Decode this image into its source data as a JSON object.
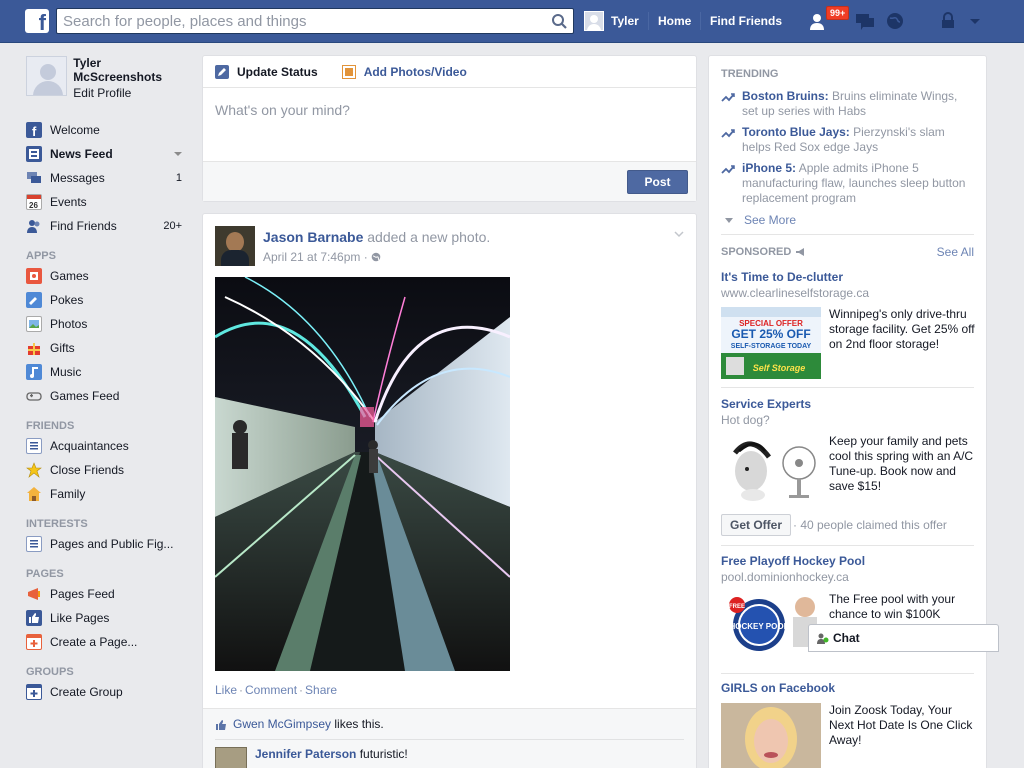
{
  "topbar": {
    "logo": "f",
    "search_placeholder": "Search for people, places and things",
    "user_name": "Tyler",
    "home": "Home",
    "find_friends": "Find Friends",
    "friend_requests_badge": "99+"
  },
  "profile": {
    "name": "Tyler McScreenshots",
    "edit": "Edit Profile"
  },
  "left_nav": {
    "main": [
      {
        "label": "Welcome",
        "icon": "facebook-icon",
        "count": ""
      },
      {
        "label": "News Feed",
        "icon": "news-feed-icon",
        "count": ""
      },
      {
        "label": "Messages",
        "icon": "messages-icon",
        "count": "1"
      },
      {
        "label": "Events",
        "icon": "calendar-icon",
        "icon_text": "26",
        "count": ""
      },
      {
        "label": "Find Friends",
        "icon": "friends-icon",
        "count": "20+"
      }
    ],
    "apps_header": "APPS",
    "apps": [
      {
        "label": "Games",
        "icon": "games-icon"
      },
      {
        "label": "Pokes",
        "icon": "pokes-icon"
      },
      {
        "label": "Photos",
        "icon": "photos-icon"
      },
      {
        "label": "Gifts",
        "icon": "gift-icon"
      },
      {
        "label": "Music",
        "icon": "music-icon"
      },
      {
        "label": "Games Feed",
        "icon": "gamepad-icon"
      }
    ],
    "friends_header": "FRIENDS",
    "friends": [
      {
        "label": "Acquaintances",
        "icon": "list-icon"
      },
      {
        "label": "Close Friends",
        "icon": "star-icon"
      },
      {
        "label": "Family",
        "icon": "house-icon"
      }
    ],
    "interests_header": "INTERESTS",
    "interests": [
      {
        "label": "Pages and Public Fig...",
        "icon": "pages-list-icon"
      }
    ],
    "pages_header": "PAGES",
    "pages": [
      {
        "label": "Pages Feed",
        "icon": "pages-feed-icon"
      },
      {
        "label": "Like Pages",
        "icon": "thumbs-up-icon"
      },
      {
        "label": "Create a Page...",
        "icon": "create-page-icon"
      }
    ],
    "groups_header": "GROUPS",
    "groups": [
      {
        "label": "Create Group",
        "icon": "create-group-icon"
      }
    ]
  },
  "composer": {
    "tab_status": "Update Status",
    "tab_photo": "Add Photos/Video",
    "placeholder": "What's on your mind?",
    "post_button": "Post"
  },
  "story": {
    "author": "Jason Barnabe",
    "action": "added a new photo.",
    "time": "April 21 at 7:46pm",
    "privacy_icon": "globe-icon",
    "actions": [
      "Like",
      "Comment",
      "Share"
    ],
    "likes_name": "Gwen McGimpsey",
    "likes_text": "likes this.",
    "comment_author": "Jennifer Paterson",
    "comment_text": "futuristic!"
  },
  "trending": {
    "header": "TRENDING",
    "items": [
      {
        "topic": "Boston Bruins:",
        "text": "Bruins eliminate Wings, set up series with Habs"
      },
      {
        "topic": "Toronto Blue Jays:",
        "text": "Pierzynski's slam helps Red Sox edge Jays"
      },
      {
        "topic": "iPhone 5:",
        "text": "Apple admits iPhone 5 manufacturing flaw, launches sleep button replacement program"
      }
    ],
    "see_more": "See More"
  },
  "sponsored": {
    "header": "SPONSORED",
    "see_all": "See All",
    "ads": [
      {
        "title": "It's Time to De-clutter",
        "url": "www.clearlineselfstorage.ca",
        "body": "Winnipeg's only drive-thru storage facility. Get 25% off on 2nd floor storage!",
        "img_text_1": "SPECIAL OFFER",
        "img_text_2": "GET 25% OFF",
        "img_text_3": "SELF-STORAGE TODAY",
        "img_text_4": "Self Storage"
      },
      {
        "title": "Service Experts",
        "url": "Hot dog?",
        "body": "Keep your family and pets cool this spring with an A/C Tune-up. Book now and save $15!",
        "button": "Get Offer",
        "claimed": "· 40 people claimed this offer"
      },
      {
        "title": "Free Playoff Hockey Pool",
        "url": "pool.dominionhockey.ca",
        "body": "The Free pool with your chance to win $100K",
        "img_text_1": "FREE",
        "img_text_2": "HOCKEY POOL"
      },
      {
        "title": "GIRLS on Facebook",
        "body": "Join Zoosk Today, Your Next Hot Date Is One Click Away!"
      }
    ]
  },
  "chat": {
    "label": "Chat"
  },
  "colors": {
    "brand": "#3b5998",
    "link": "#3b5998",
    "muted": "#9197a3",
    "badge": "#f03d25"
  }
}
